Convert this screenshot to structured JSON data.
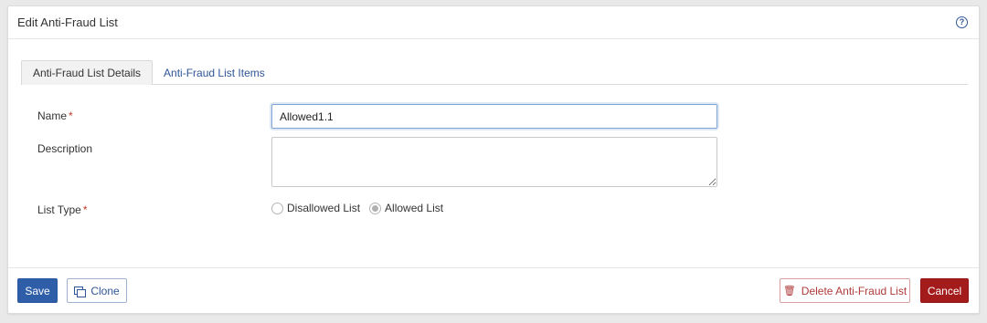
{
  "header": {
    "title": "Edit Anti-Fraud List",
    "help_icon": "?"
  },
  "tabs": [
    {
      "label": "Anti-Fraud List Details",
      "active": true
    },
    {
      "label": "Anti-Fraud List Items",
      "active": false
    }
  ],
  "form": {
    "name": {
      "label": "Name",
      "required_mark": "*",
      "value": "Allowed1.1"
    },
    "description": {
      "label": "Description",
      "value": ""
    },
    "list_type": {
      "label": "List Type",
      "required_mark": "*",
      "options": [
        {
          "label": "Disallowed List",
          "selected": false
        },
        {
          "label": "Allowed List",
          "selected": true
        }
      ]
    }
  },
  "footer": {
    "save_label": "Save",
    "clone_label": "Clone",
    "delete_label": "Delete Anti-Fraud List",
    "cancel_label": "Cancel",
    "delete_icon": "🗑"
  },
  "colors": {
    "primary": "#2f5ea9",
    "danger": "#a41b1b",
    "link": "#2f5597"
  }
}
